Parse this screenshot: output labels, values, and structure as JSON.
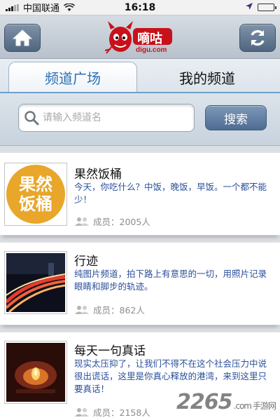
{
  "status_bar": {
    "carrier": "中国联通",
    "time": "16:18",
    "battery_level": 1.0
  },
  "header": {
    "logo_text": "嘀咕",
    "logo_subtext": "digu.com"
  },
  "tabs": [
    {
      "label": "频道广场",
      "active": true
    },
    {
      "label": "我的频道",
      "active": false
    }
  ],
  "search": {
    "placeholder": "请输入频道名",
    "button_label": "搜索"
  },
  "channels": [
    {
      "title": "果然饭桶",
      "description": "今天，你吃什么？中饭，晚饭，早饭。一个都不能少！",
      "members": "成员：2005人",
      "thumb_text": "果然饭桶"
    },
    {
      "title": "行迹",
      "description": "纯图片频道，拍下路上有意思的一切，用照片记录眼睛和脚步的轨迹。",
      "members": "成员：862人"
    },
    {
      "title": "每天一句真话",
      "description": "现实太压抑了，让我们不得不在这个社会压力中说很出谎话，这里是你真心释放的港湾，来到这里只要真话！",
      "members": "成员：2158人"
    }
  ],
  "watermark": {
    "brand": "2265",
    "domain": ".com",
    "site_name": "手游网"
  },
  "colors": {
    "accent": "#2a6fb5",
    "description_text": "#2a4f9a",
    "thumb_orange": "#e8a62a"
  }
}
